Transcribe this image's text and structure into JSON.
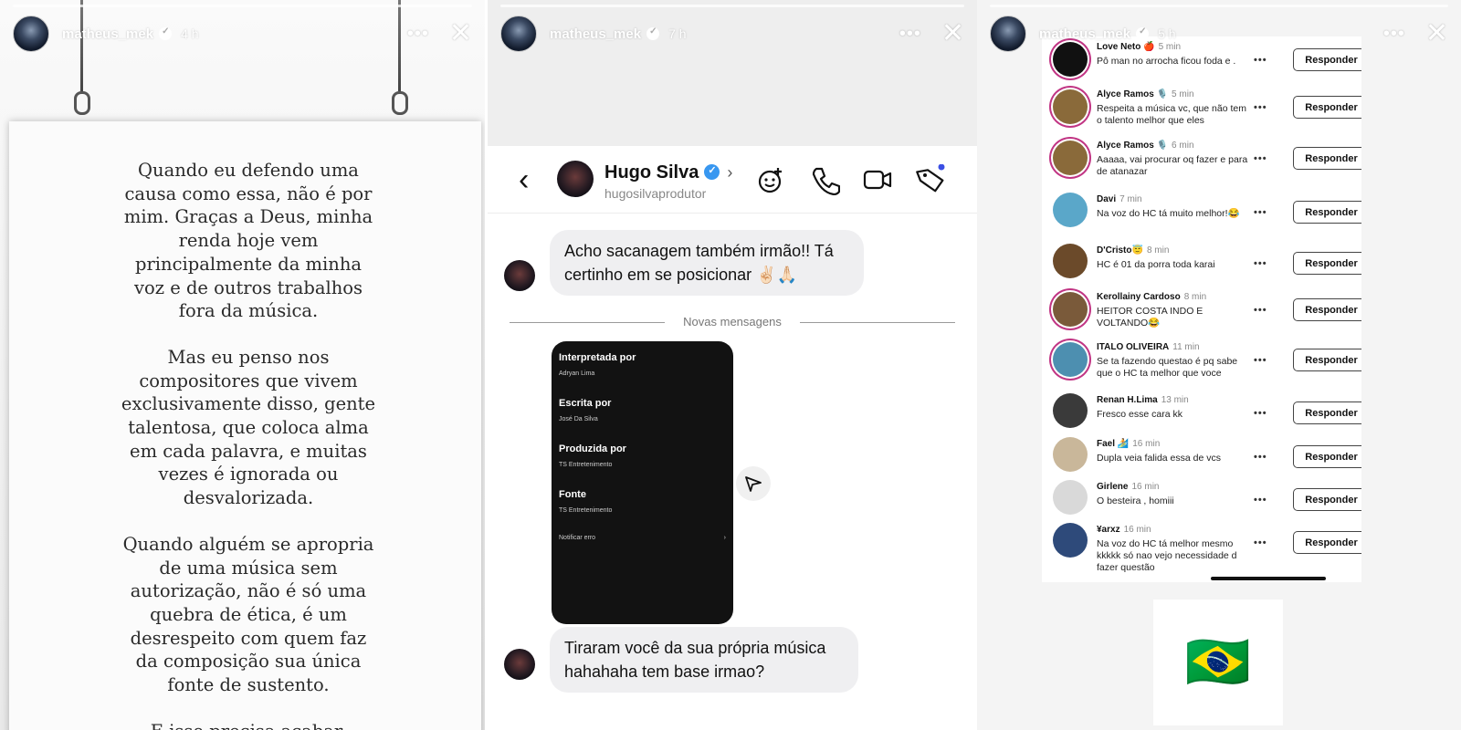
{
  "stories": [
    {
      "username": "matheus_mek",
      "time": "4 h",
      "paragraphs": [
        "Quando eu defendo uma causa como essa, não é por mim. Graças a Deus, minha renda hoje vem principalmente da minha voz e de outros trabalhos fora da música.",
        "Mas eu penso nos compositores que vivem exclusivamente disso, gente talentosa, que coloca alma em cada palavra, e muitas vezes é ignorada ou desvalorizada.",
        "Quando alguém se apropria de uma música sem autorização, não é só uma quebra de ética, é um desrespeito com quem faz da composição sua única fonte de sustento.",
        "E isso precisa acabar."
      ]
    },
    {
      "username": "matheus_mek",
      "time": "7 h",
      "dm": {
        "name": "Hugo Silva",
        "handle": "hugosilvaprodutor",
        "msg1": "Acho sacanagem também irmão!! Tá certinho em se posicionar ✌🏻🙏🏻",
        "divider": "Novas mensagens",
        "card": {
          "k1": "Interpretada por",
          "v1": "Adryan Lima",
          "k2": "Escrita por",
          "v2": "José Da Silva",
          "k3": "Produzida por",
          "v3": "TS Entretenimento",
          "k4": "Fonte",
          "v4": "TS Entretenimento",
          "notify": "Notificar erro"
        },
        "msg2": "Tiraram você da sua própria música hahahaha tem base irmao?"
      }
    },
    {
      "username": "matheus_mek",
      "time": "5 h",
      "reply_label": "Responder",
      "comments": [
        {
          "name": "Love Neto 🍎",
          "time": "5 min",
          "text": "Pô man no arrocha ficou foda e .",
          "avatar_color": "#111111"
        },
        {
          "name": "Alyce Ramos 🎙️",
          "time": "5 min",
          "text": "Respeita a música vc, que não tem o talento melhor que eles",
          "avatar_color": "#8a6a3a"
        },
        {
          "name": "Alyce Ramos 🎙️",
          "time": "6 min",
          "text": "Aaaaa, vai procurar oq fazer e para de atanazar",
          "avatar_color": "#8a6a3a"
        },
        {
          "name": "Davi",
          "time": "7 min",
          "text": "Na voz do HC tá muito melhor!😂",
          "avatar_color": "#5aa7c9"
        },
        {
          "name": "D'Cristo😇",
          "time": "8 min",
          "text": "HC é 01 da porra toda karai",
          "avatar_color": "#6b4a2a"
        },
        {
          "name": "Kerollainy Cardoso",
          "time": "8 min",
          "text": "HEITOR COSTA INDO E VOLTANDO😂",
          "avatar_color": "#7a5a3a"
        },
        {
          "name": "ITALO OLIVEIRA",
          "time": "11 min",
          "text": "Se ta fazendo questao é pq sabe que o HC ta melhor que voce",
          "avatar_color": "#4d8fb0"
        },
        {
          "name": "Renan H.Lima",
          "time": "13 min",
          "text": "Fresco esse cara kk",
          "avatar_color": "#3a3a3a"
        },
        {
          "name": "Fael 🏄",
          "time": "16 min",
          "text": "Dupla veia falida essa de vcs",
          "avatar_color": "#c9b79a"
        },
        {
          "name": "Girlene",
          "time": "16 min",
          "text": "O besteira , homiii",
          "avatar_color": "#d9d9d9"
        },
        {
          "name": "¥arxz",
          "time": "16 min",
          "text": "Na voz do HC tá melhor mesmo kkkkk só nao vejo necessidade d fazer questão",
          "avatar_color": "#2e4a7a"
        }
      ],
      "flag": "🇧🇷"
    }
  ],
  "colors": {
    "dm_bubble": "#efeff1",
    "verified_blue": "#3897f0",
    "card_bg": "#121212"
  }
}
